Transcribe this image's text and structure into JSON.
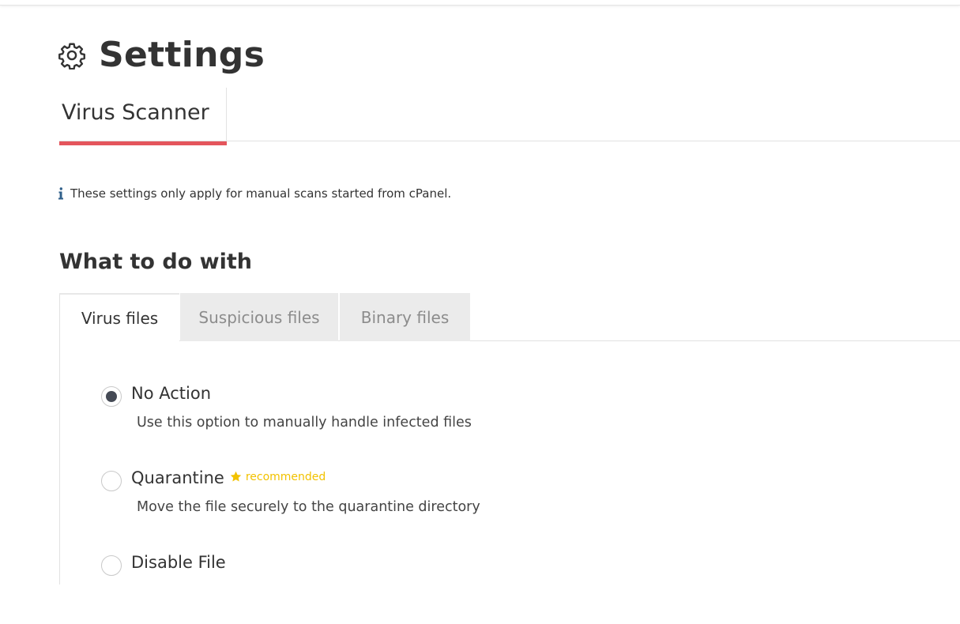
{
  "page": {
    "title": "Settings",
    "icon": "gear-icon"
  },
  "main_tabs": [
    {
      "label": "Virus Scanner",
      "active": true
    }
  ],
  "info_note": {
    "icon": "info-icon",
    "text": "These settings only apply for manual scans started from cPanel."
  },
  "section": {
    "heading": "What to do with"
  },
  "sub_tabs": [
    {
      "label": "Virus files",
      "active": true
    },
    {
      "label": "Suspicious files",
      "active": false
    },
    {
      "label": "Binary files",
      "active": false
    }
  ],
  "options": [
    {
      "label": "No Action",
      "description": "Use this option to manually handle infected files",
      "selected": true
    },
    {
      "label": "Quarantine",
      "badge": "recommended",
      "description": "Move the file securely to the quarantine directory",
      "selected": false
    },
    {
      "label": "Disable File",
      "selected": false
    }
  ],
  "colors": {
    "accent_underline": "#e4555c",
    "recommended": "#f2c200",
    "radio_checked": "#454a55",
    "inactive_tab_bg": "#ebebeb"
  }
}
